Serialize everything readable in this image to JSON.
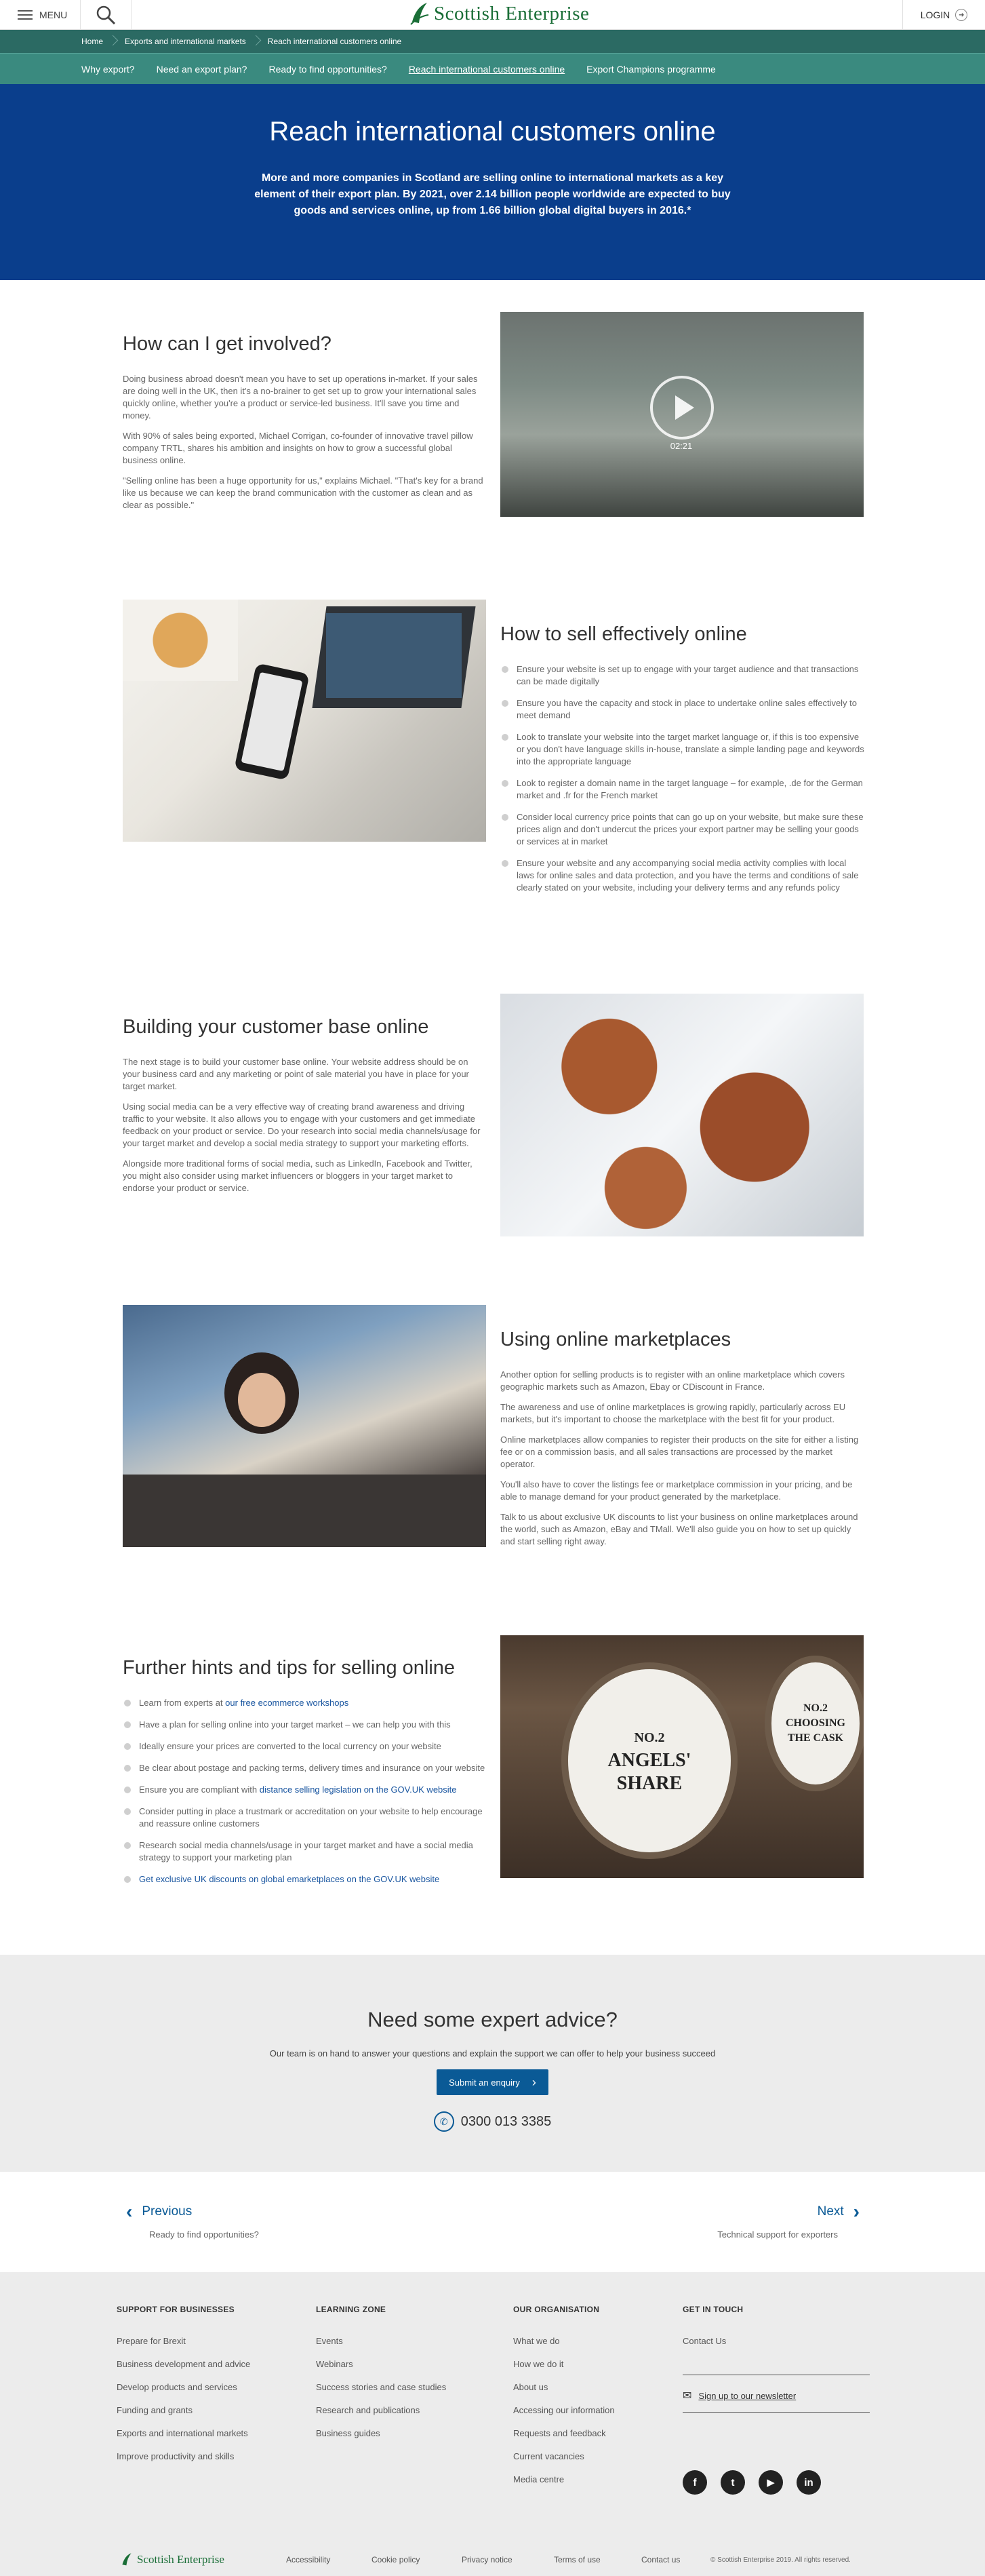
{
  "header": {
    "menu_label": "MENU",
    "logo_text": "Scottish Enterprise",
    "login_label": "LOGIN"
  },
  "breadcrumb": [
    "Home",
    "Exports and international markets",
    "Reach international customers online"
  ],
  "subnav": [
    "Why export?",
    "Need an export plan?",
    "Ready to find opportunities?",
    "Reach international customers online",
    "Export Champions programme"
  ],
  "hero": {
    "title": "Reach international customers online",
    "text": "More and more companies in Scotland are selling online to international markets as a key element of their export plan. By 2021, over 2.14 billion people worldwide are expected to buy goods and services online, up from 1.66 billion global digital buyers in 2016.*"
  },
  "involved": {
    "title": "How can I get involved?",
    "p1": "Doing business abroad doesn't mean you have to set up operations in-market. If your sales are doing well in the UK, then it's a no-brainer to get set up to grow your international sales quickly online, whether you're a product or service-led business. It'll save you time and money.",
    "p2": "With 90% of sales being exported, Michael Corrigan, co-founder of innovative travel pillow company TRTL, shares his ambition and insights on how to grow a successful global business online.",
    "p3": "\"Selling online has been a huge opportunity for us,\" explains Michael. \"That's key for a brand like us because we can keep the brand communication with the customer as clean and as clear as possible.\"",
    "video_time": "02:21"
  },
  "sell": {
    "title": "How to sell effectively online",
    "items": [
      "Ensure your website is set up to engage with your target audience and that transactions can be made digitally",
      "Ensure you have the capacity and stock in place to undertake online sales effectively to meet demand",
      "Look to translate your website into the target market language or, if this is too expensive or you don't have language skills in-house, translate a simple landing page and keywords into the appropriate language",
      "Look to register a domain name in the target language – for example, .de for the German market and .fr for the French market",
      "Consider local currency price points that can go up on your website, but make sure these prices align and don't undercut the prices your export partner may be selling your goods or services at in market",
      "Ensure your website and any accompanying social media activity complies with local laws for online sales and data protection, and you have the terms and conditions of sale clearly stated on your website, including your delivery terms and any refunds policy"
    ]
  },
  "building": {
    "title": "Building your customer base online",
    "p1": "The next stage is to build your customer base online. Your website address should be on your business card and any marketing or point of sale material you have in place for your target market.",
    "p2": "Using social media can be a very effective way of creating brand awareness and driving traffic to your website. It also allows you to engage with your customers and get immediate feedback on your product or service. Do your research into social media channels/usage for your target market and develop a social media strategy to support your marketing efforts.",
    "p3": "Alongside more traditional forms of social media, such as LinkedIn, Facebook and Twitter, you might also consider using market influencers or bloggers in your target market to endorse your product or service."
  },
  "marketplaces": {
    "title": "Using online marketplaces",
    "p1": "Another option for selling products is to register with an online marketplace which covers geographic markets such as Amazon, Ebay or CDiscount in France.",
    "p2": "The awareness and use of online marketplaces is growing rapidly, particularly across EU markets, but it's important to choose the marketplace with the best fit for your product.",
    "p3": "Online marketplaces allow companies to register their products on the site for either a listing fee or on a commission basis, and all sales transactions are processed by the market operator.",
    "p4": "You'll also have to cover the listings fee or marketplace commission in your pricing, and be able to manage demand for your product generated by the marketplace.",
    "p5": "Talk to us about exclusive UK discounts to list your business on online marketplaces around the world, such as Amazon, eBay and TMall. We'll also guide you on how to set up quickly and start selling right away."
  },
  "hints": {
    "title": "Further hints and tips for selling online",
    "i1_pre": "Learn from experts at ",
    "i1_link": "our free ecommerce workshops",
    "i2": "Have a plan for selling online into your target market – we can help you with this",
    "i3": "Ideally ensure your prices are converted to the local currency on your website",
    "i4": "Be clear about postage and packing terms, delivery times and insurance on your website",
    "i5_pre": "Ensure you are compliant with ",
    "i5_link": "distance selling legislation on the GOV.UK website",
    "i6": "Consider putting in place a trustmark or accreditation on your website to help encourage and reassure online customers",
    "i7": "Research social media channels/usage in your target market and have a social media strategy to support your marketing plan",
    "i8_link": "Get exclusive UK discounts on global emarketplaces on the GOV.UK website",
    "barrel1": [
      "NO.2",
      "ANGELS'",
      "SHARE"
    ],
    "barrel2": [
      "NO.2",
      "CHOOSING",
      "THE CASK"
    ]
  },
  "advice": {
    "title": "Need some expert advice?",
    "text": "Our team is on hand to answer your questions and explain the support we can offer to help your business succeed",
    "button": "Submit an enquiry",
    "phone": "0300 013 3385"
  },
  "pager": {
    "prev": "Previous",
    "prev_sub": "Ready to find opportunities?",
    "next": "Next",
    "next_sub": "Technical support for exporters"
  },
  "footer": {
    "col1": {
      "title": "SUPPORT FOR BUSINESSES",
      "links": [
        "Prepare for Brexit",
        "Business development and advice",
        "Develop products and services",
        "Funding and grants",
        "Exports and international markets",
        "Improve productivity and skills"
      ]
    },
    "col2": {
      "title": "LEARNING ZONE",
      "links": [
        "Events",
        "Webinars",
        "Success stories and case studies",
        "Research and publications",
        "Business guides"
      ]
    },
    "col3": {
      "title": "OUR ORGANISATION",
      "links": [
        "What we do",
        "How we do it",
        "About us",
        "Accessing our information",
        "Requests and feedback",
        "Current vacancies",
        "Media centre"
      ]
    },
    "col4": {
      "title": "GET IN TOUCH",
      "links": [
        "Contact Us"
      ],
      "newsletter": "Sign up to our newsletter"
    },
    "social": [
      "f",
      "t",
      "▶",
      "in"
    ],
    "legal": [
      "Accessibility",
      "Cookie policy",
      "Privacy notice",
      "Terms of use",
      "Contact us"
    ],
    "copyright": "© Scottish Enterprise 2019. All rights reserved."
  }
}
